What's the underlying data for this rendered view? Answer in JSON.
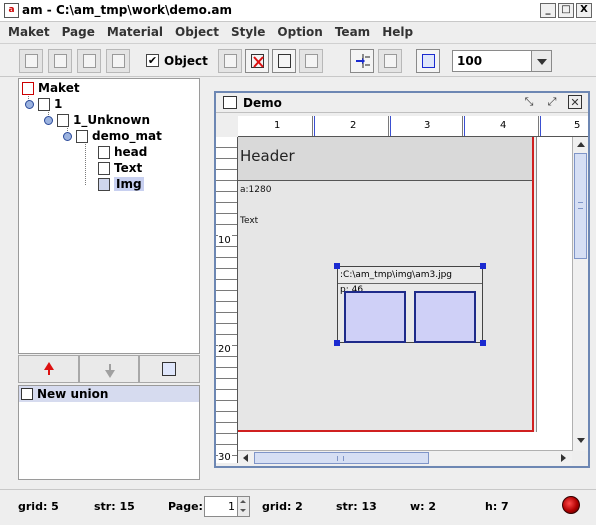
{
  "window": {
    "title": "am - C:\\am_tmp\\work\\demo.am",
    "controls": [
      "_",
      "□",
      "X"
    ]
  },
  "menu": [
    "Maket",
    "Page",
    "Material",
    "Object",
    "Style",
    "Option",
    "Team",
    "Help"
  ],
  "toolbar": {
    "object_checkbox_label": "Object",
    "object_checked": true,
    "zoom_value": "100"
  },
  "tree": {
    "root": "Maket",
    "page": "1",
    "unknown": "1_Unknown",
    "material": "demo_mat",
    "items": [
      "head",
      "Text",
      "Img"
    ],
    "selected_item": "Img"
  },
  "union": {
    "label": "New union"
  },
  "demo_window": {
    "title": "Demo",
    "ruler_top": [
      "1",
      "2",
      "3",
      "4",
      "5"
    ],
    "ruler_left": [
      "10",
      "20",
      "30"
    ],
    "header_text": "Header",
    "field_a": "a:1280",
    "field_text": "Text",
    "img_path": ":C:\\am_tmp\\img\\am3.jpg",
    "img_size": "p: 46"
  },
  "status": {
    "grid_left": "grid: 5",
    "str_left": "str: 15",
    "page_label": "Page:",
    "page_value": "1",
    "grid_right": "grid: 2",
    "str_right": "str: 13",
    "w": "w: 2",
    "h": "h: 7"
  },
  "colors": {
    "accent_blue": "#1a2ad0",
    "page_border": "#d02020",
    "selection": "#c8d0f0",
    "status_light": "#d00000"
  }
}
